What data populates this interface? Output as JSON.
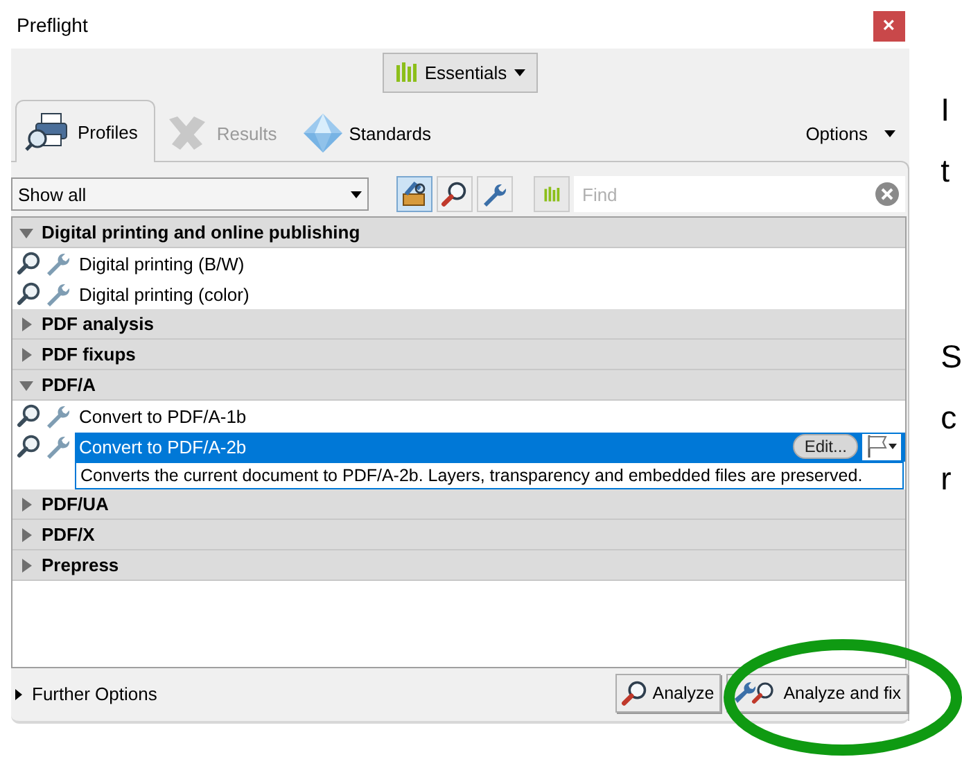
{
  "window": {
    "title": "Preflight",
    "close": "×"
  },
  "workspace_button": {
    "label": "Essentials"
  },
  "tabs": [
    {
      "label": "Profiles",
      "selected": true,
      "disabled": false,
      "kind": "printer"
    },
    {
      "label": "Results",
      "selected": false,
      "disabled": true,
      "kind": "results"
    },
    {
      "label": "Standards",
      "selected": false,
      "disabled": false,
      "kind": "diamond"
    }
  ],
  "options_menu": {
    "label": "Options"
  },
  "filter": {
    "value": "Show all"
  },
  "toolbar_toggles": [
    {
      "kind": "toolbox",
      "selected": true
    },
    {
      "kind": "magnifier",
      "selected": false
    },
    {
      "kind": "wrench",
      "selected": false
    }
  ],
  "search": {
    "placeholder": "Find"
  },
  "groups": [
    {
      "name": "Digital printing and online publishing",
      "expanded": true,
      "items": [
        {
          "name": "Digital printing (B/W)",
          "selected": false
        },
        {
          "name": "Digital printing (color)",
          "selected": false
        }
      ]
    },
    {
      "name": "PDF analysis",
      "expanded": false
    },
    {
      "name": "PDF fixups",
      "expanded": false
    },
    {
      "name": "PDF/A",
      "expanded": true,
      "items": [
        {
          "name": "Convert to PDF/A-1b",
          "selected": false
        },
        {
          "name": "Convert to PDF/A-2b",
          "selected": true,
          "edit": "Edit...",
          "description": "Converts the current document to PDF/A-2b. Layers, transparency and embedded files are preserved."
        }
      ]
    },
    {
      "name": "PDF/UA",
      "expanded": false
    },
    {
      "name": "PDF/X",
      "expanded": false
    },
    {
      "name": "Prepress",
      "expanded": false
    }
  ],
  "further_options": {
    "label": "Further Options",
    "expanded": false
  },
  "buttons": [
    {
      "label": "Analyze",
      "kind": "analyze"
    },
    {
      "label": "Analyze and fix",
      "kind": "fix"
    }
  ],
  "background_text": [
    "I",
    "t",
    "S",
    "c",
    "r"
  ]
}
